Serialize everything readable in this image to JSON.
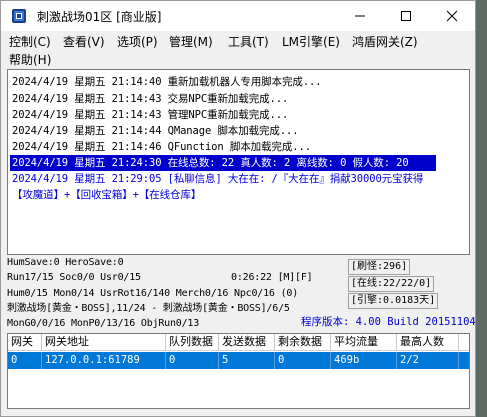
{
  "window": {
    "title": "刺激战场01区 [商业版]"
  },
  "menu": [
    {
      "label": "控制(C)"
    },
    {
      "label": "查看(V)"
    },
    {
      "label": "选项(P)"
    },
    {
      "label": "管理(M)"
    },
    {
      "label": "工具(T)"
    },
    {
      "label": "LM引擎(E)"
    },
    {
      "label": "鸿盾网关(Z)"
    },
    {
      "label": "帮助(H)"
    }
  ],
  "log": [
    {
      "text": "2024/4/19 星期五 21:14:40 重新加载机器人专用脚本完成..."
    },
    {
      "text": "2024/4/19 星期五 21:14:43 交易NPC重新加载完成..."
    },
    {
      "text": "2024/4/19 星期五 21:14:43 管理NPC重新加载完成..."
    },
    {
      "text": "2024/4/19 星期五 21:14:44 QManage 脚本加载完成..."
    },
    {
      "text": "2024/4/19 星期五 21:14:46 QFunction 脚本加载完成..."
    },
    {
      "text": "2024/4/19 星期五 21:24:30 在线总数: 22 真人数: 2 离线数: 0 假人数: 20"
    },
    {
      "text": "2024/4/19 星期五 21:29:05 [私聊信息] 大在在: /『大在在』捐献30000元宝获得"
    },
    {
      "text": "【攻魔道】+【回收宝箱】+【在线仓库】"
    }
  ],
  "status": {
    "line1": "HumSave:0 HeroSave:0",
    "line2": "Run17/15 Soc0/0 Usr0/15",
    "time": "0:26:22 [M][F]",
    "line3": "Hum0/15 Mon0/14 UsrRot16/140 Merch0/16 Npc0/16 (0)",
    "line4": "刺激战场[黄金・BOSS],11/24 - 刺激战场[黄金・BOSS]/6/5",
    "line5": "MonG0/0/16 MonP0/13/16 ObjRun0/13",
    "refresh": "[刷怪:296]",
    "online": "[在线:22/22/0]",
    "engine": "[引擎:0.0183天]",
    "version": "程序版本: 4.00 Build 20151104"
  },
  "grid": {
    "headers": [
      "网关",
      "网关地址",
      "队列数据",
      "发送数据",
      "剩余数据",
      "平均流量",
      "最高人数"
    ],
    "rows": [
      [
        "0",
        "127.0.0.1:61789",
        "0",
        "5",
        "0",
        "469b",
        "2/2"
      ]
    ]
  },
  "colors": {
    "highlight": "#0000cc",
    "selected_row": "#0078d7",
    "link_text": "#0000dd"
  }
}
